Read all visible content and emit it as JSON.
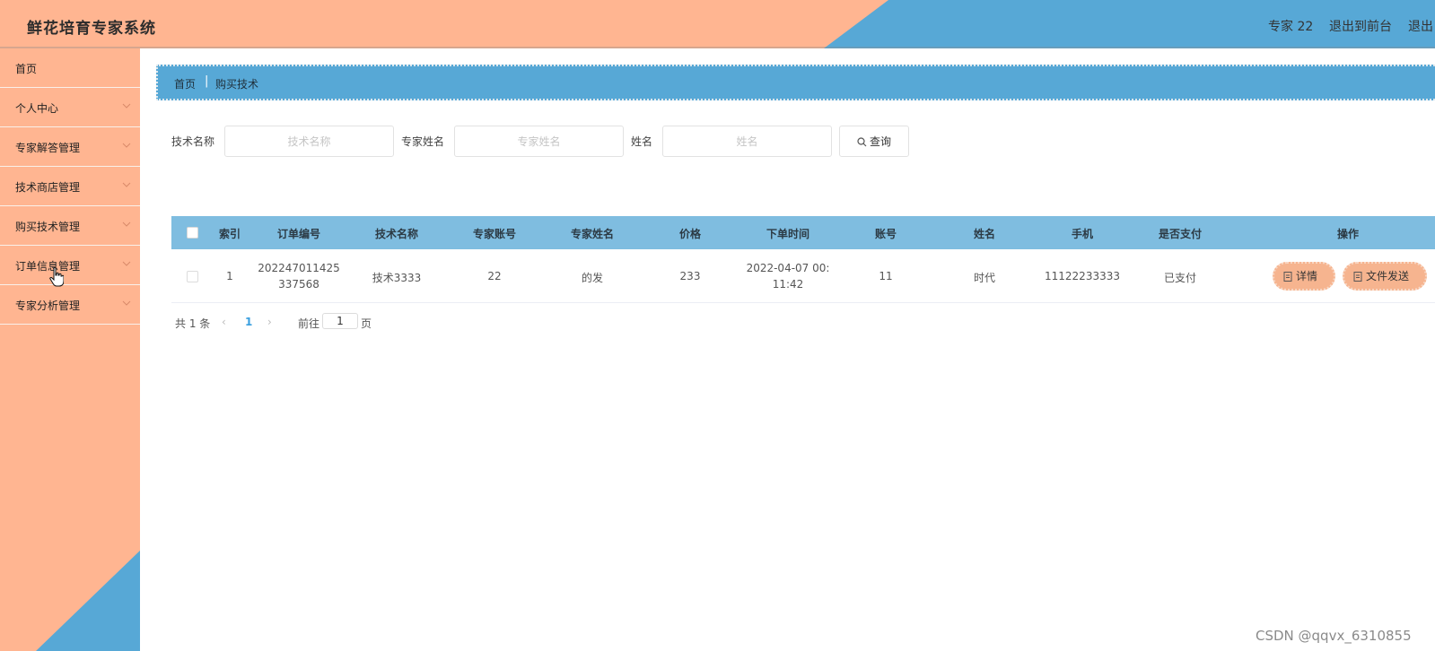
{
  "header": {
    "title": "鲜花培育专家系统",
    "user": "专家 22",
    "front_link": "退出到前台",
    "logout_link": "退出",
    "colors": {
      "salmon": "#ffb591",
      "blue": "#57a8d6"
    }
  },
  "sidebar": {
    "items": [
      {
        "label": "首页",
        "has_chevron": false
      },
      {
        "label": "个人中心",
        "has_chevron": true
      },
      {
        "label": "专家解答管理",
        "has_chevron": true
      },
      {
        "label": "技术商店管理",
        "has_chevron": true
      },
      {
        "label": "购买技术管理",
        "has_chevron": true
      },
      {
        "label": "订单信息管理",
        "has_chevron": true
      },
      {
        "label": "专家分析管理",
        "has_chevron": true
      }
    ]
  },
  "breadcrumb": {
    "home": "首页",
    "separator": "|",
    "current": "购买技术"
  },
  "search": {
    "tech_name_label": "技术名称",
    "tech_name_placeholder": "技术名称",
    "expert_name_label": "专家姓名",
    "expert_name_placeholder": "专家姓名",
    "name_label": "姓名",
    "name_placeholder": "姓名",
    "button_label": "查询"
  },
  "table": {
    "columns": [
      "索引",
      "订单编号",
      "技术名称",
      "专家账号",
      "专家姓名",
      "价格",
      "下单时间",
      "账号",
      "姓名",
      "手机",
      "是否支付",
      "操作"
    ],
    "rows": [
      {
        "index": "1",
        "order_no": "202247011425 337568",
        "tech_name": "技术3333",
        "expert_account": "22",
        "expert_name": "的发",
        "price": "233",
        "order_time": "2022-04-07 00: 11:42",
        "account": "11",
        "name": "时代",
        "phone": "11122233333",
        "paid": "已支付",
        "detail_label": "详情",
        "send_label": "文件发送"
      }
    ]
  },
  "pagination": {
    "total": "共 1 条",
    "prev": "‹",
    "current_page": "1",
    "next": "›",
    "goto_label": "前往",
    "goto_value": "1",
    "page_suffix": "页"
  },
  "watermark": "CSDN @qqvx_6310855"
}
